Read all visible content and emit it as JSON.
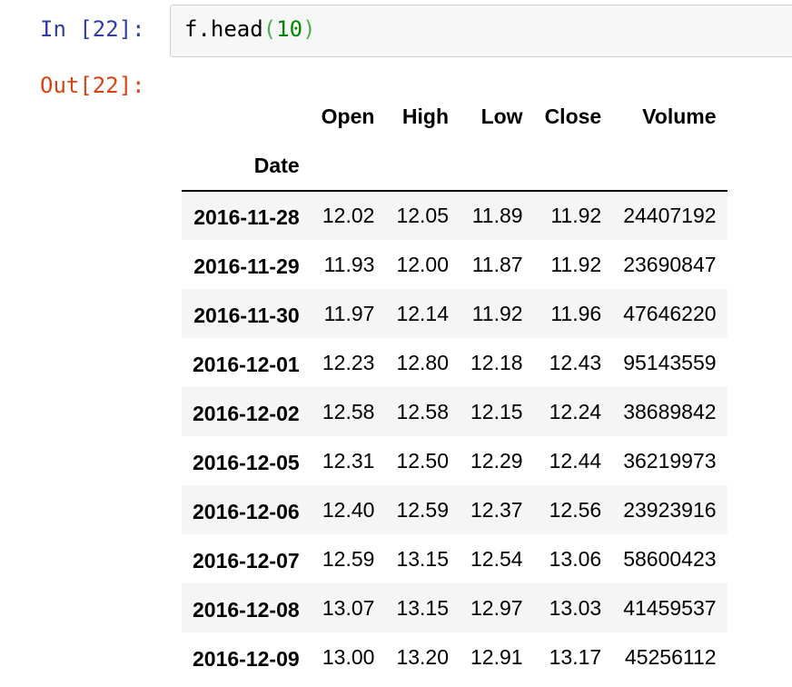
{
  "input_prompt": "In [22]:",
  "output_prompt": "Out[22]:",
  "code": {
    "object": "f",
    "dot": ".",
    "method": "head",
    "open_paren": "(",
    "arg": "10",
    "close_paren": ")"
  },
  "dataframe": {
    "columns": [
      "Open",
      "High",
      "Low",
      "Close",
      "Volume"
    ],
    "index_name": "Date",
    "rows": [
      {
        "date": "2016-11-28",
        "values": [
          "12.02",
          "12.05",
          "11.89",
          "11.92",
          "24407192"
        ]
      },
      {
        "date": "2016-11-29",
        "values": [
          "11.93",
          "12.00",
          "11.87",
          "11.92",
          "23690847"
        ]
      },
      {
        "date": "2016-11-30",
        "values": [
          "11.97",
          "12.14",
          "11.92",
          "11.96",
          "47646220"
        ]
      },
      {
        "date": "2016-12-01",
        "values": [
          "12.23",
          "12.80",
          "12.18",
          "12.43",
          "95143559"
        ]
      },
      {
        "date": "2016-12-02",
        "values": [
          "12.58",
          "12.58",
          "12.15",
          "12.24",
          "38689842"
        ]
      },
      {
        "date": "2016-12-05",
        "values": [
          "12.31",
          "12.50",
          "12.29",
          "12.44",
          "36219973"
        ]
      },
      {
        "date": "2016-12-06",
        "values": [
          "12.40",
          "12.59",
          "12.37",
          "12.56",
          "23923916"
        ]
      },
      {
        "date": "2016-12-07",
        "values": [
          "12.59",
          "13.15",
          "12.54",
          "13.06",
          "58600423"
        ]
      },
      {
        "date": "2016-12-08",
        "values": [
          "13.07",
          "13.15",
          "12.97",
          "13.03",
          "41459537"
        ]
      },
      {
        "date": "2016-12-09",
        "values": [
          "13.00",
          "13.20",
          "12.91",
          "13.17",
          "45256112"
        ]
      }
    ]
  }
}
